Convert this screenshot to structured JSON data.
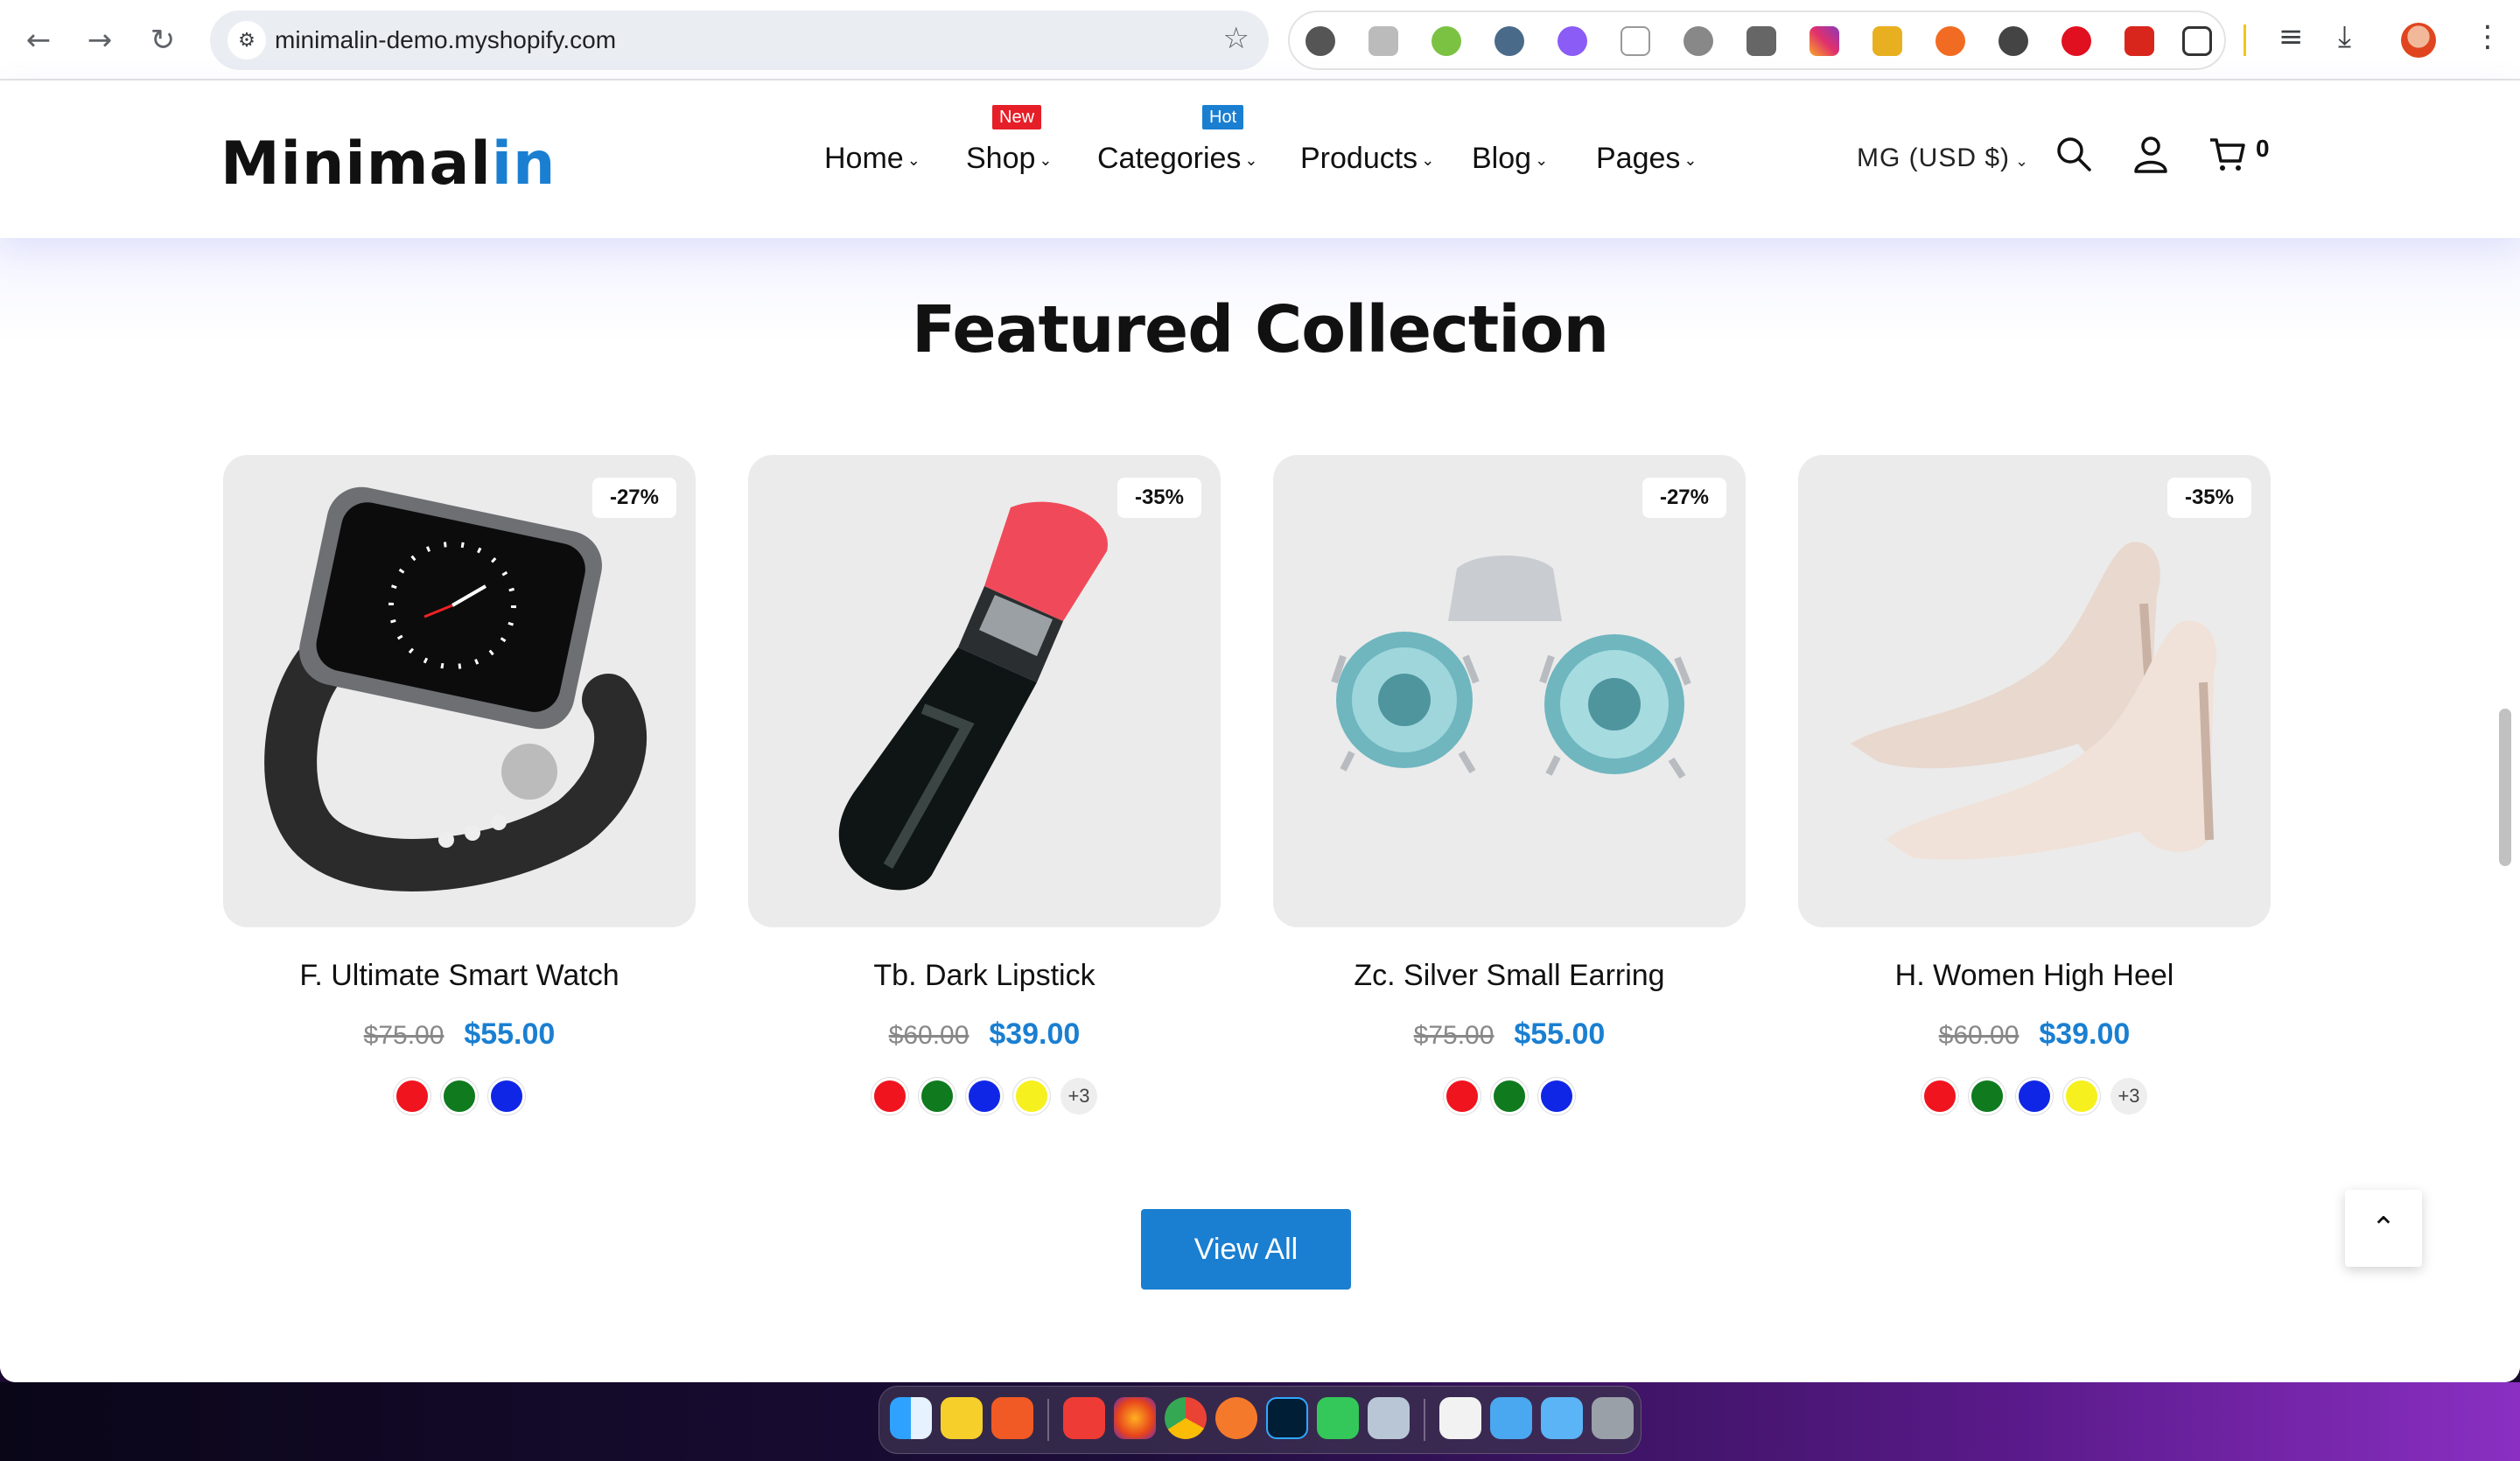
{
  "browser": {
    "url": "minimalin-demo.myshopify.com",
    "back_icon": "arrow-left-icon",
    "forward_icon": "arrow-right-icon",
    "reload_icon": "reload-icon",
    "bookmark_icon": "star-icon",
    "extensions": [
      "robot-extension-icon",
      "translate-extension-icon",
      "android-extension-icon",
      "globe-extension-icon",
      "k-extension-icon",
      "device-extension-icon",
      "shield-extension-icon",
      "qr-extension-icon",
      "instagram-extension-icon",
      "mail-extension-icon",
      "sync-extension-icon",
      "privacy-extension-icon",
      "opera-extension-icon",
      "pdf-extension-icon",
      "puzzle-extensions-icon"
    ]
  },
  "header": {
    "logo_main": "Minimal",
    "logo_accent": "in",
    "nav": [
      {
        "label": "Home"
      },
      {
        "label": "Shop",
        "badge": "New",
        "badge_color": "#e61e28"
      },
      {
        "label": "Categories",
        "badge": "Hot",
        "badge_color": "#1a7fd1"
      },
      {
        "label": "Products"
      },
      {
        "label": "Blog"
      },
      {
        "label": "Pages"
      }
    ],
    "currency": "MG (USD $)",
    "cart_count": "0"
  },
  "section": {
    "title": "Featured Collection",
    "view_all": "View All"
  },
  "products": [
    {
      "title": "F. Ultimate Smart Watch",
      "discount": "-27%",
      "old_price": "$75.00",
      "price": "$55.00",
      "colors": [
        "#f0141e",
        "#0f7a1e",
        "#1026e6"
      ],
      "more": ""
    },
    {
      "title": "Tb. Dark Lipstick",
      "discount": "-35%",
      "old_price": "$60.00",
      "price": "$39.00",
      "colors": [
        "#f0141e",
        "#0f7a1e",
        "#1026e6",
        "#f6f01e"
      ],
      "more": "+3"
    },
    {
      "title": "Zc. Silver Small Earring",
      "discount": "-27%",
      "old_price": "$75.00",
      "price": "$55.00",
      "colors": [
        "#f0141e",
        "#0f7a1e",
        "#1026e6"
      ],
      "more": ""
    },
    {
      "title": "H. Women High Heel",
      "discount": "-35%",
      "old_price": "$60.00",
      "price": "$39.00",
      "colors": [
        "#f0141e",
        "#0f7a1e",
        "#1026e6",
        "#f6f01e"
      ],
      "more": "+3"
    }
  ],
  "colors": {
    "accent": "#1a7fd1",
    "badge_new": "#e61e28",
    "badge_hot": "#1a7fd1"
  },
  "dock": [
    "finder-icon",
    "notes-icon",
    "brave-icon",
    "anydesk-icon",
    "firefox-icon",
    "chrome-icon",
    "blender-icon",
    "photoshop-icon",
    "messages-icon",
    "preview-icon",
    "textedit-icon",
    "appstore-folder-icon",
    "folder-icon",
    "trash-icon"
  ]
}
